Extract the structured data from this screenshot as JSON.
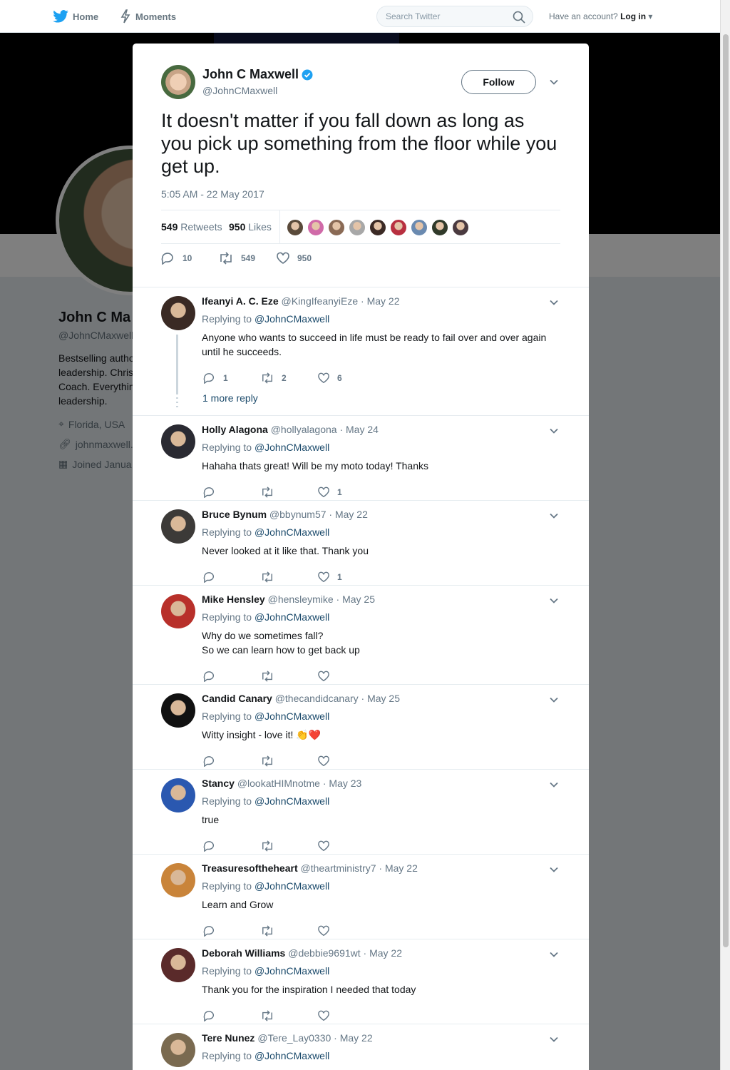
{
  "nav": {
    "home_label": "Home",
    "moments_label": "Moments",
    "search_placeholder": "Search Twitter",
    "account_prompt": "Have an account?",
    "login_label": "Log in",
    "close_symbol": "✕"
  },
  "profile": {
    "name": "John C Ma",
    "handle": "@JohnCMaxwell",
    "bio_lines": [
      "Bestselling autho",
      "leadership. Chris",
      "Coach. Everythin",
      "leadership."
    ],
    "location": "Florida, USA",
    "website": "johnmaxwell.c",
    "joined": "Joined Janua"
  },
  "tweet": {
    "author_name": "John C Maxwell",
    "author_handle": "@JohnCMaxwell",
    "follow_label": "Follow",
    "text": "It doesn't matter if you fall down as long as you pick up something from the floor while you get up.",
    "timestamp": "5:05 AM - 22 May 2017",
    "retweets_count": "549",
    "retweets_label": "Retweets",
    "likes_count": "950",
    "likes_label": "Likes",
    "reply_count": "10",
    "retweet_action_count": "549",
    "like_action_count": "950",
    "liker_colors": [
      "#5a4a3a",
      "#d06aa8",
      "#8a6a55",
      "#a8a8a8",
      "#3b2a25",
      "#b83040",
      "#6a8ab0",
      "#303a2a",
      "#4a3a40"
    ]
  },
  "replies": [
    {
      "name": "Ifeanyi A. C. Eze",
      "handle": "@KingIfeanyiEze",
      "date": "· May 22",
      "replying_label": "Replying to",
      "replying_to": "@JohnCMaxwell",
      "text": "Anyone who wants to succeed in life must be ready to fail over and over again until he succeeds.",
      "replies": "1",
      "retweets": "2",
      "likes": "6",
      "more_label": "1 more reply",
      "avatar_color": "#3a2a24"
    },
    {
      "name": "Holly Alagona",
      "handle": "@hollyalagona",
      "date": "· May 24",
      "replying_label": "Replying to",
      "replying_to": "@JohnCMaxwell",
      "text": "Hahaha thats great! Will be my moto today! Thanks",
      "replies": "",
      "retweets": "",
      "likes": "1",
      "avatar_color": "#2a2a32"
    },
    {
      "name": "Bruce Bynum",
      "handle": "@bbynum57",
      "date": "· May 22",
      "replying_label": "Replying to",
      "replying_to": "@JohnCMaxwell",
      "text": "Never looked at it like that. Thank you",
      "replies": "",
      "retweets": "",
      "likes": "1",
      "avatar_color": "#3c3a38"
    },
    {
      "name": "Mike Hensley",
      "handle": "@hensleymike",
      "date": "· May 25",
      "replying_label": "Replying to",
      "replying_to": "@JohnCMaxwell",
      "text_lines": [
        "Why do we sometimes fall?",
        "So we can learn how to get back up"
      ],
      "replies": "",
      "retweets": "",
      "likes": "",
      "avatar_color": "#b8302a"
    },
    {
      "name": "Candid Canary",
      "handle": "@thecandidcanary",
      "date": "· May 25",
      "replying_label": "Replying to",
      "replying_to": "@JohnCMaxwell",
      "text": "Witty insight - love it! 👏❤️",
      "replies": "",
      "retweets": "",
      "likes": "",
      "avatar_color": "#111111"
    },
    {
      "name": "Stancy",
      "handle": "@lookatHIMnotme",
      "date": "· May 23",
      "replying_label": "Replying to",
      "replying_to": "@JohnCMaxwell",
      "text": "true",
      "replies": "",
      "retweets": "",
      "likes": "",
      "avatar_color": "#2a58b0"
    },
    {
      "name": "Treasuresoftheheart",
      "handle": "@theartministry7",
      "date": "· May 22",
      "replying_label": "Replying to",
      "replying_to": "@JohnCMaxwell",
      "text": "Learn and Grow",
      "replies": "",
      "retweets": "",
      "likes": "",
      "avatar_color": "#c9843a"
    },
    {
      "name": "Deborah Williams",
      "handle": "@debbie9691wt",
      "date": "· May 22",
      "replying_label": "Replying to",
      "replying_to": "@JohnCMaxwell",
      "text": "Thank you for the inspiration I needed that today",
      "replies": "",
      "retweets": "",
      "likes": "",
      "avatar_color": "#5a2a2a"
    },
    {
      "name": "Tere Nunez",
      "handle": "@Tere_Lay0330",
      "date": "· May 22",
      "replying_label": "Replying to",
      "replying_to": "@JohnCMaxwell",
      "avatar_color": "#7a6a50"
    }
  ],
  "colors": {
    "brand": "#1da1f2",
    "link": "#1b4a6b",
    "muted": "#657786"
  }
}
